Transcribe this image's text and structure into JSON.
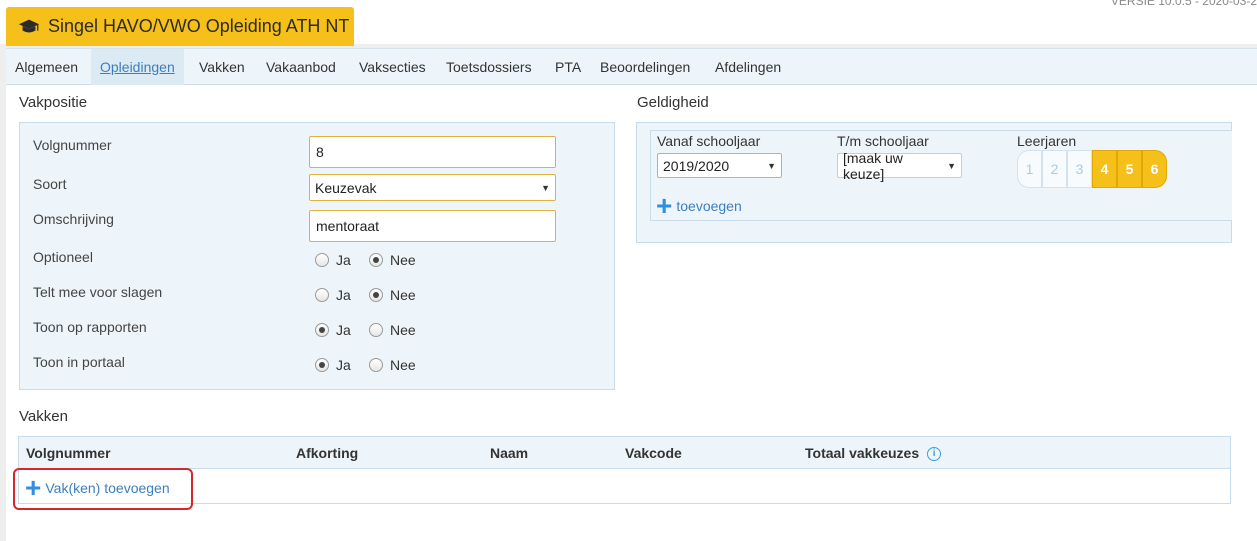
{
  "header": {
    "title": "Singel HAVO/VWO Opleiding ATH NT",
    "version": "VERSIE 10.0.5 - 2020-03-2"
  },
  "tabs": [
    {
      "label": "Algemeen"
    },
    {
      "label": "Opleidingen",
      "active": true
    },
    {
      "label": "Vakken"
    },
    {
      "label": "Vakaanbod"
    },
    {
      "label": "Vaksecties"
    },
    {
      "label": "Toetsdossiers"
    },
    {
      "label": "PTA"
    },
    {
      "label": "Beoordelingen"
    },
    {
      "label": "Afdelingen"
    }
  ],
  "vakpositie": {
    "title": "Vakpositie",
    "volgnummer_label": "Volgnummer",
    "volgnummer_value": "8",
    "soort_label": "Soort",
    "soort_value": "Keuzevak",
    "omschrijving_label": "Omschrijving",
    "omschrijving_value": "mentoraat",
    "optioneel_label": "Optioneel",
    "telt_label": "Telt mee voor slagen",
    "rapporten_label": "Toon op rapporten",
    "portaal_label": "Toon in portaal",
    "ja": "Ja",
    "nee": "Nee",
    "radios": {
      "optioneel": "Nee",
      "telt": "Nee",
      "rapporten": "Ja",
      "portaal": "Ja"
    }
  },
  "geldigheid": {
    "title": "Geldigheid",
    "vanaf_label": "Vanaf schooljaar",
    "vanaf_value": "2019/2020",
    "tm_label": "T/m schooljaar",
    "tm_value": "[maak uw keuze]",
    "leerjaren_label": "Leerjaren",
    "leerjaren": [
      {
        "label": "1",
        "selected": false
      },
      {
        "label": "2",
        "selected": false
      },
      {
        "label": "3",
        "selected": false
      },
      {
        "label": "4",
        "selected": true
      },
      {
        "label": "5",
        "selected": true
      },
      {
        "label": "6",
        "selected": true
      }
    ],
    "add_label": "toevoegen"
  },
  "vakken": {
    "title": "Vakken",
    "columns": [
      "Volgnummer",
      "Afkorting",
      "Naam",
      "Vakcode",
      "Totaal vakkeuzes"
    ],
    "add_label": "Vak(ken) toevoegen"
  },
  "colors": {
    "accent": "#f6c01a",
    "panel": "#eef5fa",
    "link": "#3b7fbf",
    "highlight": "#d9262c"
  }
}
